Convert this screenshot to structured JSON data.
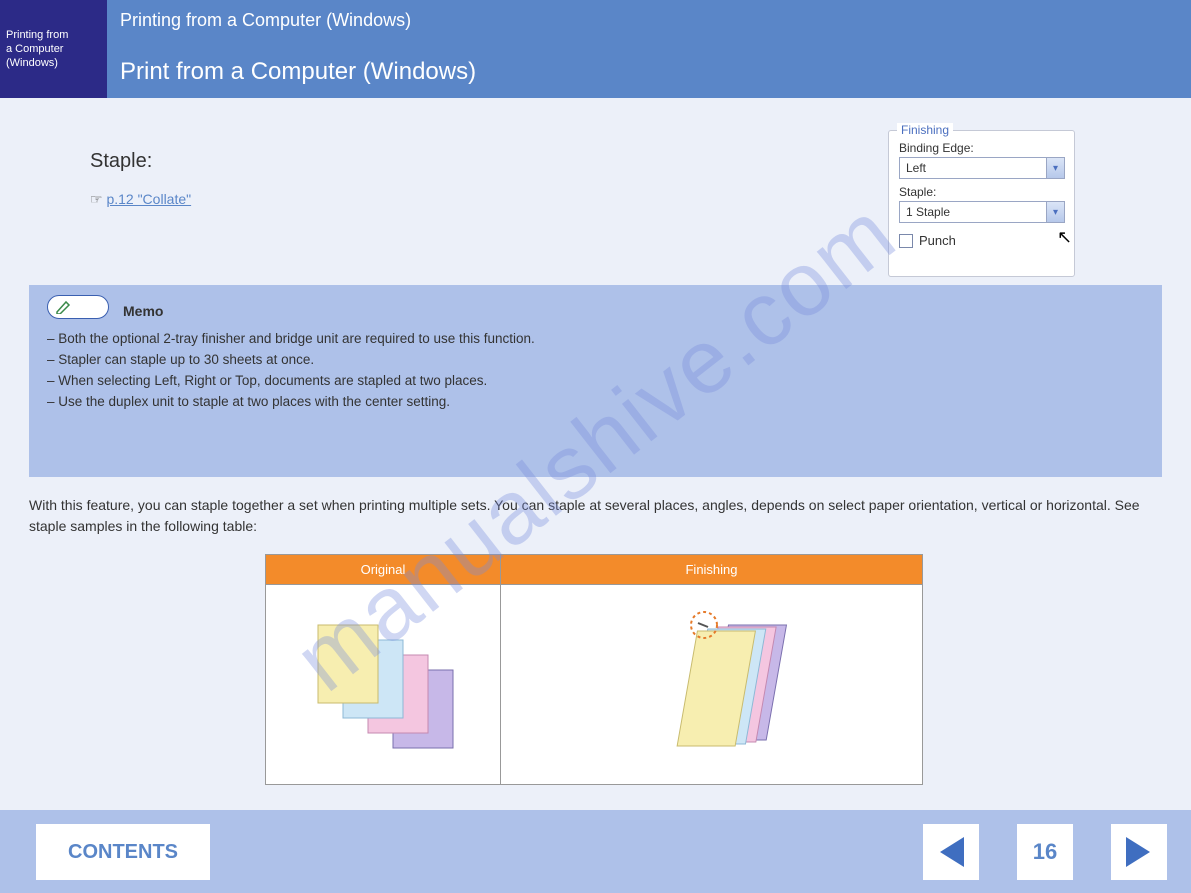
{
  "header": {
    "brand_line1": "Printing from",
    "brand_line2": "a Computer",
    "brand_line3": "(Windows)",
    "breadcrumb": "Printing from a Computer (Windows)",
    "title": "Print from a Computer (Windows)"
  },
  "content": {
    "staple_heading": "Staple:",
    "crossref_prefix": "☞",
    "crossref_link": "p.12 \"Collate\""
  },
  "finishing": {
    "legend": "Finishing",
    "binding_label": "Binding Edge:",
    "binding_value": "Left",
    "staple_label": "Staple:",
    "staple_value": "1 Staple",
    "punch_label": "Punch"
  },
  "memo": {
    "title": "Memo",
    "items": [
      "Both the optional 2-tray finisher and bridge unit are required to use this function.",
      "Stapler can staple up to 30 sheets at once.",
      "When selecting Left, Right or Top, documents are stapled at two places.",
      "Use the duplex unit to staple at two places with the center setting."
    ]
  },
  "staple_paragraph": "With this feature, you can staple together a set when printing multiple sets. You can staple at several places, angles, depends on select paper orientation, vertical or horizontal. See staple samples in the following table:",
  "table": {
    "col1": "Original",
    "col2": "Finishing"
  },
  "footer": {
    "contents": "CONTENTS",
    "page": "16"
  },
  "watermark": "manualshive.com"
}
